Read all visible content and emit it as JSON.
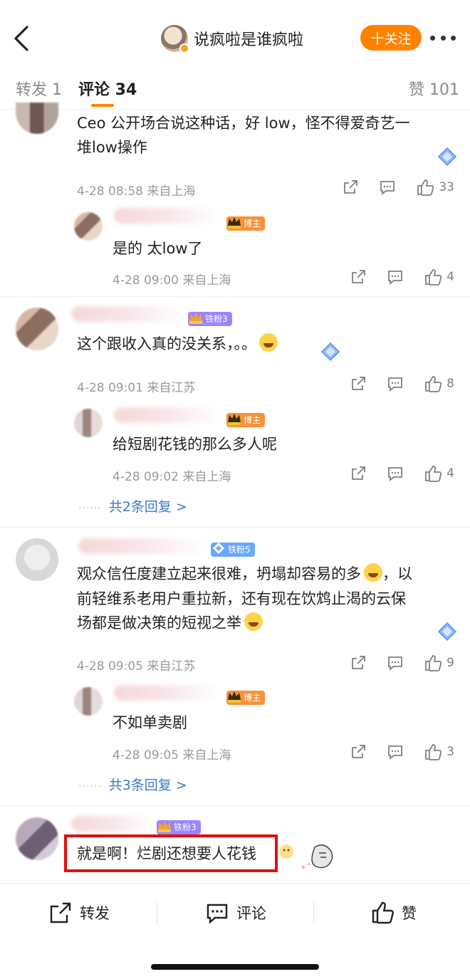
{
  "header": {
    "title": "说疯啦是谁疯啦",
    "follow_label": "十关注"
  },
  "tabs": [
    {
      "label": "转发 1"
    },
    {
      "label": "评论 34"
    },
    {
      "label": "赞 101"
    }
  ],
  "comments": [
    {
      "text_line1": "Ceo 公开场合说这种话，好 low，怪不得爱奇艺一",
      "text_line2": "堆low操作",
      "meta": "4-28 08:58  来自上海",
      "likes": "33",
      "reply": {
        "badge": "博主",
        "text": "是的 太low了",
        "meta": "4-28 09:00  来自上海",
        "likes": "4"
      }
    },
    {
      "badge": "铁粉3",
      "text": "这个跟收入真的没关系，。。",
      "meta": "4-28 09:01  来自江苏",
      "likes": "8",
      "reply": {
        "badge": "博主",
        "text": "给短剧花钱的那么多人呢",
        "meta": "4-28 09:02  来自上海",
        "likes": "4"
      },
      "more_replies": "共2条回复 >"
    },
    {
      "badge": "铁粉5",
      "text_line1": "观众信任度建立起来很难，坍塌却容易的多",
      "text_line1b": "，以",
      "text_line2": "前轻维系老用户重拉新，还有现在饮鸩止渴的云保",
      "text_line3": "场都是做决策的短视之举",
      "meta": "4-28 09:05  来自江苏",
      "likes": "9",
      "reply": {
        "badge": "博主",
        "text": "不如单卖剧",
        "meta": "4-28 09:05  来自上海",
        "likes": "3"
      },
      "more_replies": "共3条回复 >"
    },
    {
      "badge": "铁粉3",
      "text": "就是啊！烂剧还想要人花钱"
    }
  ],
  "bottom_bar": {
    "repost": "转发",
    "comment": "评论",
    "like": "赞"
  },
  "colors": {
    "accent": "#ff8200",
    "link": "#3a79c5",
    "highlight": "#e01010"
  }
}
